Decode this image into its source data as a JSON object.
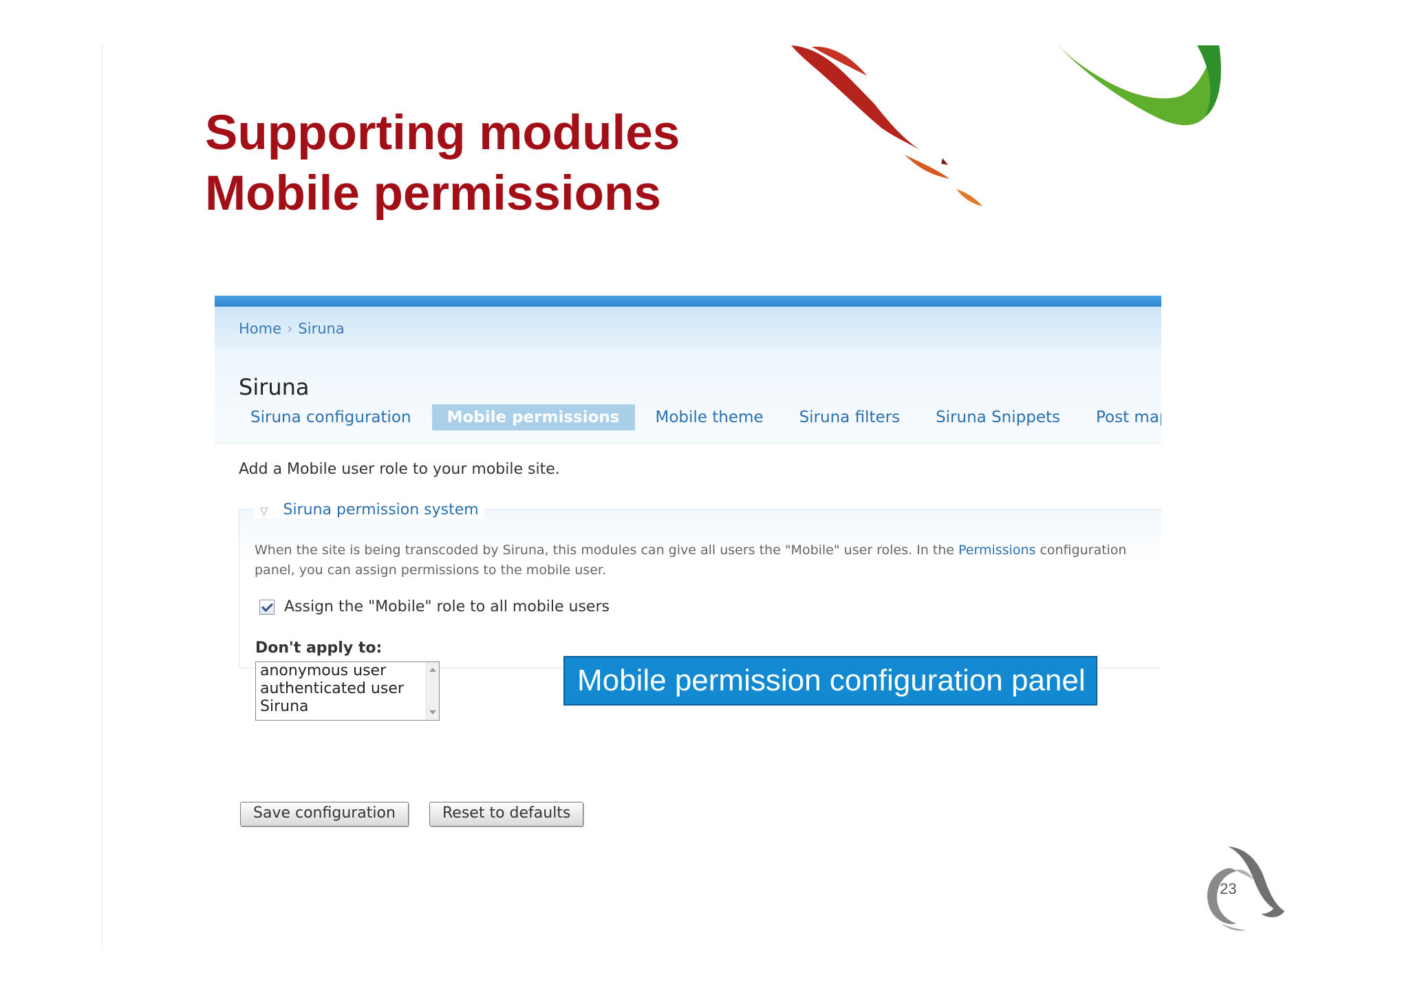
{
  "slide": {
    "title_line1": "Supporting modules",
    "title_line2": "Mobile permissions",
    "page_number": "23"
  },
  "screenshot": {
    "breadcrumb": [
      "Home",
      "Siruna"
    ],
    "breadcrumb_separator": "›",
    "page_heading": "Siruna",
    "tabs": [
      {
        "label": "Siruna configuration",
        "active": false
      },
      {
        "label": "Mobile permissions",
        "active": true
      },
      {
        "label": "Mobile theme",
        "active": false
      },
      {
        "label": "Siruna filters",
        "active": false
      },
      {
        "label": "Siruna Snippets",
        "active": false
      },
      {
        "label": "Post mapp",
        "active": false
      }
    ],
    "intro_text": "Add a Mobile user role to your mobile site.",
    "fieldset": {
      "legend": "Siruna permission system",
      "description_before_link": "When the site is being transcoded by Siruna, this modules can give all users the \"Mobile\" user roles. In the ",
      "description_link": "Permissions",
      "description_after_link": " configuration panel, you can assign permissions to the mobile user.",
      "checkbox_label": "Assign the \"Mobile\" role to all mobile users",
      "checkbox_checked": true,
      "exclude_label": "Don't apply to:",
      "exclude_options": [
        "anonymous user",
        "authenticated user",
        "Siruna"
      ]
    },
    "buttons": {
      "save": "Save configuration",
      "reset": "Reset to defaults"
    }
  },
  "callout": "Mobile permission configuration panel",
  "colors": {
    "title": "#a30f17",
    "callout_bg": "#1289d0",
    "link": "#2a6fb0",
    "active_tab": "#a9cfe9"
  }
}
